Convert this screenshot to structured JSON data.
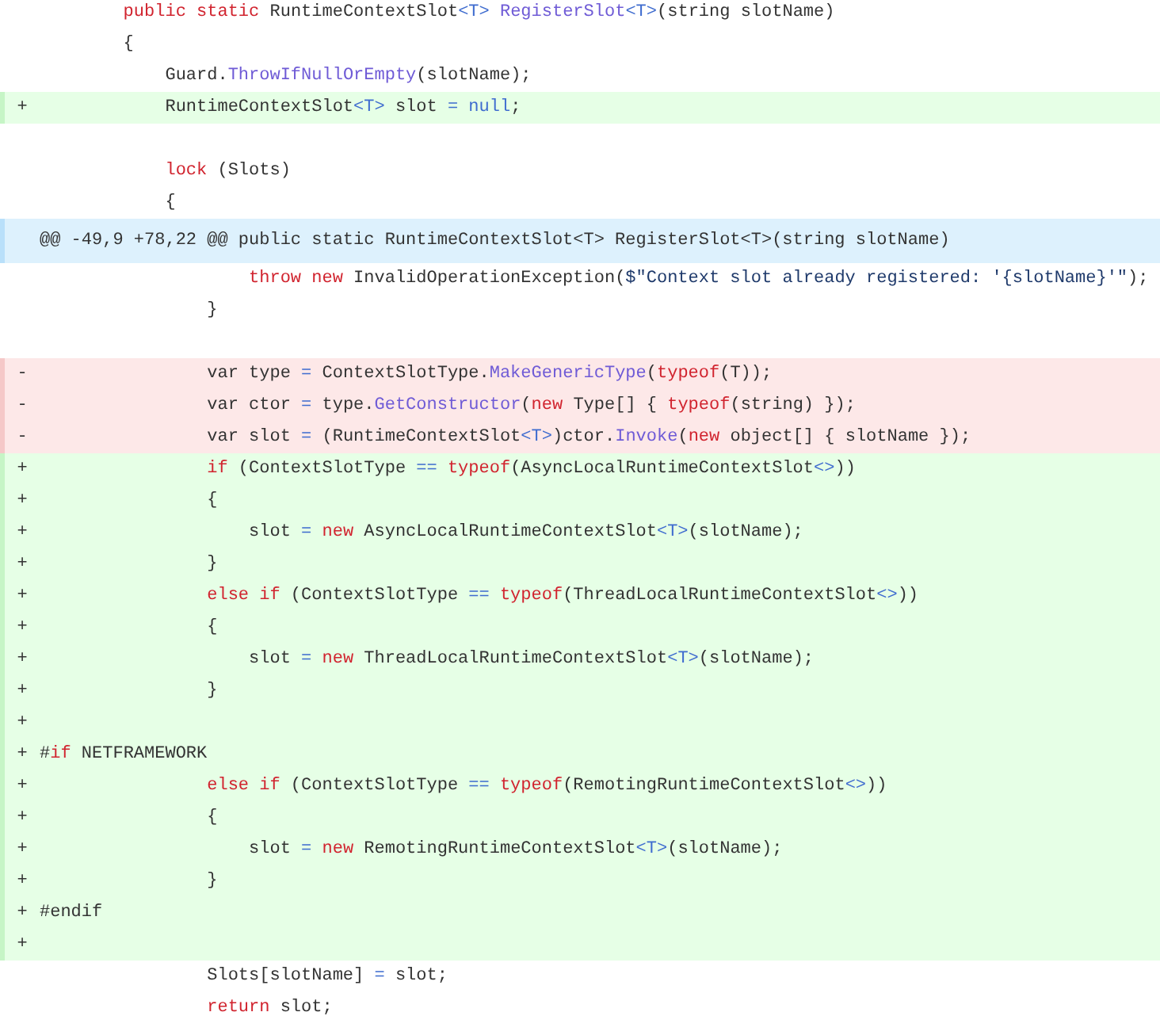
{
  "diff": {
    "lines": [
      {
        "kind": "context",
        "tokens": [
          {
            "text": "        public",
            "kind": "keyword"
          },
          {
            "text": " static",
            "kind": "keyword"
          },
          {
            "text": " RuntimeContextSlot",
            "kind": "plain"
          },
          {
            "text": "<T>",
            "kind": "generic"
          },
          {
            "text": " RegisterSlot",
            "kind": "method"
          },
          {
            "text": "<T>",
            "kind": "generic"
          },
          {
            "text": "(string slotName)",
            "kind": "plain"
          }
        ]
      },
      {
        "kind": "context",
        "tokens": [
          {
            "text": "        {",
            "kind": "plain"
          }
        ]
      },
      {
        "kind": "context",
        "tokens": [
          {
            "text": "            Guard.",
            "kind": "plain"
          },
          {
            "text": "ThrowIfNullOrEmpty",
            "kind": "method"
          },
          {
            "text": "(slotName);",
            "kind": "plain"
          }
        ]
      },
      {
        "kind": "added",
        "sign": "+",
        "tokens": [
          {
            "text": "            RuntimeContextSlot",
            "kind": "plain"
          },
          {
            "text": "<T>",
            "kind": "generic"
          },
          {
            "text": " slot ",
            "kind": "plain"
          },
          {
            "text": "=",
            "kind": "generic"
          },
          {
            "text": " null",
            "kind": "generic"
          },
          {
            "text": ";",
            "kind": "plain"
          }
        ]
      },
      {
        "kind": "context"
      },
      {
        "kind": "context",
        "tokens": [
          {
            "text": "            lock",
            "kind": "keyword"
          },
          {
            "text": " (Slots)",
            "kind": "plain"
          }
        ]
      },
      {
        "kind": "context",
        "tokens": [
          {
            "text": "            {",
            "kind": "plain"
          }
        ]
      },
      {
        "kind": "hunk",
        "text": "@@ -49,9 +78,22 @@ public static RuntimeContextSlot<T> RegisterSlot<T>(string slotName)"
      },
      {
        "kind": "context",
        "tokens": [
          {
            "text": "                    throw",
            "kind": "keyword"
          },
          {
            "text": " new",
            "kind": "keyword"
          },
          {
            "text": " InvalidOperationException(",
            "kind": "plain"
          },
          {
            "text": "$\"Context slot already registered: '{slotName}'\"",
            "kind": "string"
          },
          {
            "text": ");",
            "kind": "plain"
          }
        ]
      },
      {
        "kind": "context",
        "tokens": [
          {
            "text": "                }",
            "kind": "plain"
          }
        ]
      },
      {
        "kind": "context"
      },
      {
        "kind": "removed",
        "sign": "-",
        "tokens": [
          {
            "text": "                var type ",
            "kind": "plain"
          },
          {
            "text": "=",
            "kind": "generic"
          },
          {
            "text": " ContextSlotType.",
            "kind": "plain"
          },
          {
            "text": "MakeGenericType",
            "kind": "method"
          },
          {
            "text": "(",
            "kind": "plain"
          },
          {
            "text": "typeof",
            "kind": "keyword"
          },
          {
            "text": "(T));",
            "kind": "plain"
          }
        ]
      },
      {
        "kind": "removed",
        "sign": "-",
        "tokens": [
          {
            "text": "                var ctor ",
            "kind": "plain"
          },
          {
            "text": "=",
            "kind": "generic"
          },
          {
            "text": " type.",
            "kind": "plain"
          },
          {
            "text": "GetConstructor",
            "kind": "method"
          },
          {
            "text": "(",
            "kind": "plain"
          },
          {
            "text": "new",
            "kind": "keyword"
          },
          {
            "text": " Type[] { ",
            "kind": "plain"
          },
          {
            "text": "typeof",
            "kind": "keyword"
          },
          {
            "text": "(string) });",
            "kind": "plain"
          }
        ]
      },
      {
        "kind": "removed",
        "sign": "-",
        "tokens": [
          {
            "text": "                var slot ",
            "kind": "plain"
          },
          {
            "text": "=",
            "kind": "generic"
          },
          {
            "text": " (RuntimeContextSlot",
            "kind": "plain"
          },
          {
            "text": "<T>",
            "kind": "generic"
          },
          {
            "text": ")ctor.",
            "kind": "plain"
          },
          {
            "text": "Invoke",
            "kind": "method"
          },
          {
            "text": "(",
            "kind": "plain"
          },
          {
            "text": "new",
            "kind": "keyword"
          },
          {
            "text": " object[] { slotName });",
            "kind": "plain"
          }
        ]
      },
      {
        "kind": "added",
        "sign": "+",
        "tokens": [
          {
            "text": "                if",
            "kind": "keyword"
          },
          {
            "text": " (ContextSlotType ",
            "kind": "plain"
          },
          {
            "text": "==",
            "kind": "generic"
          },
          {
            "text": " typeof",
            "kind": "keyword"
          },
          {
            "text": "(AsyncLocalRuntimeContextSlot",
            "kind": "plain"
          },
          {
            "text": "<>",
            "kind": "generic"
          },
          {
            "text": "))",
            "kind": "plain"
          }
        ]
      },
      {
        "kind": "added",
        "sign": "+",
        "tokens": [
          {
            "text": "                {",
            "kind": "plain"
          }
        ]
      },
      {
        "kind": "added",
        "sign": "+",
        "tokens": [
          {
            "text": "                    slot ",
            "kind": "plain"
          },
          {
            "text": "=",
            "kind": "generic"
          },
          {
            "text": " new",
            "kind": "keyword"
          },
          {
            "text": " AsyncLocalRuntimeContextSlot",
            "kind": "plain"
          },
          {
            "text": "<T>",
            "kind": "generic"
          },
          {
            "text": "(slotName);",
            "kind": "plain"
          }
        ]
      },
      {
        "kind": "added",
        "sign": "+",
        "tokens": [
          {
            "text": "                }",
            "kind": "plain"
          }
        ]
      },
      {
        "kind": "added",
        "sign": "+",
        "tokens": [
          {
            "text": "                else if",
            "kind": "keyword"
          },
          {
            "text": " (ContextSlotType ",
            "kind": "plain"
          },
          {
            "text": "==",
            "kind": "generic"
          },
          {
            "text": " typeof",
            "kind": "keyword"
          },
          {
            "text": "(ThreadLocalRuntimeContextSlot",
            "kind": "plain"
          },
          {
            "text": "<>",
            "kind": "generic"
          },
          {
            "text": "))",
            "kind": "plain"
          }
        ]
      },
      {
        "kind": "added",
        "sign": "+",
        "tokens": [
          {
            "text": "                {",
            "kind": "plain"
          }
        ]
      },
      {
        "kind": "added",
        "sign": "+",
        "tokens": [
          {
            "text": "                    slot ",
            "kind": "plain"
          },
          {
            "text": "=",
            "kind": "generic"
          },
          {
            "text": " new",
            "kind": "keyword"
          },
          {
            "text": " ThreadLocalRuntimeContextSlot",
            "kind": "plain"
          },
          {
            "text": "<T>",
            "kind": "generic"
          },
          {
            "text": "(slotName);",
            "kind": "plain"
          }
        ]
      },
      {
        "kind": "added",
        "sign": "+",
        "tokens": [
          {
            "text": "                }",
            "kind": "plain"
          }
        ]
      },
      {
        "kind": "added",
        "sign": "+"
      },
      {
        "kind": "added",
        "sign": "+",
        "tokens": [
          {
            "text": "#",
            "kind": "plain"
          },
          {
            "text": "if",
            "kind": "keyword"
          },
          {
            "text": " NETFRAMEWORK",
            "kind": "plain"
          }
        ]
      },
      {
        "kind": "added",
        "sign": "+",
        "tokens": [
          {
            "text": "                else if",
            "kind": "keyword"
          },
          {
            "text": " (ContextSlotType ",
            "kind": "plain"
          },
          {
            "text": "==",
            "kind": "generic"
          },
          {
            "text": " typeof",
            "kind": "keyword"
          },
          {
            "text": "(RemotingRuntimeContextSlot",
            "kind": "plain"
          },
          {
            "text": "<>",
            "kind": "generic"
          },
          {
            "text": "))",
            "kind": "plain"
          }
        ]
      },
      {
        "kind": "added",
        "sign": "+",
        "tokens": [
          {
            "text": "                {",
            "kind": "plain"
          }
        ]
      },
      {
        "kind": "added",
        "sign": "+",
        "tokens": [
          {
            "text": "                    slot ",
            "kind": "plain"
          },
          {
            "text": "=",
            "kind": "generic"
          },
          {
            "text": " new",
            "kind": "keyword"
          },
          {
            "text": " RemotingRuntimeContextSlot",
            "kind": "plain"
          },
          {
            "text": "<T>",
            "kind": "generic"
          },
          {
            "text": "(slotName);",
            "kind": "plain"
          }
        ]
      },
      {
        "kind": "added",
        "sign": "+",
        "tokens": [
          {
            "text": "                }",
            "kind": "plain"
          }
        ]
      },
      {
        "kind": "added",
        "sign": "+",
        "tokens": [
          {
            "text": "#endif",
            "kind": "plain"
          }
        ]
      },
      {
        "kind": "added",
        "sign": "+"
      },
      {
        "kind": "context",
        "tokens": [
          {
            "text": "                Slots[slotName] ",
            "kind": "plain"
          },
          {
            "text": "=",
            "kind": "generic"
          },
          {
            "text": " slot;",
            "kind": "plain"
          }
        ]
      },
      {
        "kind": "context",
        "tokens": [
          {
            "text": "                return",
            "kind": "keyword"
          },
          {
            "text": " slot;",
            "kind": "plain"
          }
        ]
      }
    ]
  }
}
